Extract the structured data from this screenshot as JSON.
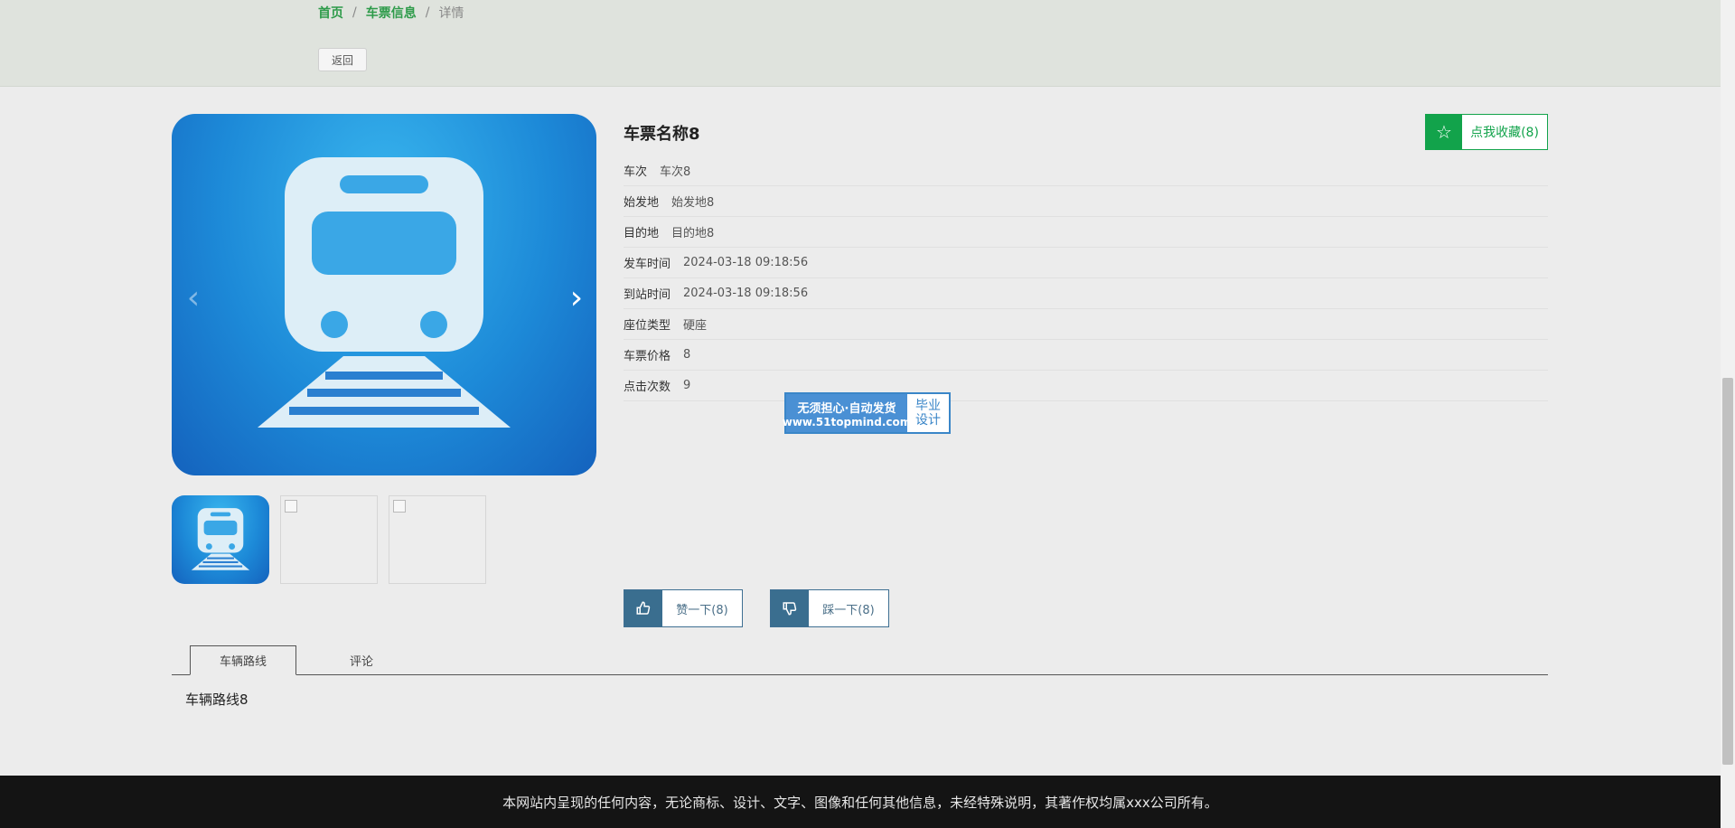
{
  "breadcrumb": {
    "home": "首页",
    "sep1": "/",
    "list": "车票信息",
    "sep2": "/",
    "current": "详情"
  },
  "back_label": "返回",
  "carousel": {
    "prev": "‹",
    "next": "›"
  },
  "ticket": {
    "title": "车票名称8",
    "favorite_label": "点我收藏(8)",
    "fields": [
      {
        "label": "车次",
        "value": "车次8"
      },
      {
        "label": "始发地",
        "value": "始发地8"
      },
      {
        "label": "目的地",
        "value": "目的地8"
      },
      {
        "label": "发车时间",
        "value": "2024-03-18 09:18:56"
      },
      {
        "label": "到站时间",
        "value": "2024-03-18 09:18:56"
      },
      {
        "label": "座位类型",
        "value": "硬座"
      },
      {
        "label": "车票价格",
        "value": "8"
      },
      {
        "label": "点击次数",
        "value": "9"
      }
    ]
  },
  "watermark": {
    "line1": "无须担心·自动发货",
    "line2": "www.51topmind.com",
    "right1": "毕业",
    "right2": "设计"
  },
  "votes": {
    "up_label": "赞一下(8)",
    "down_label": "踩一下(8)"
  },
  "tabs": [
    {
      "label": "车辆路线"
    },
    {
      "label": "评论"
    }
  ],
  "tab_content": "车辆路线8",
  "footer": "本网站内呈现的任何内容，无论商标、设计、文字、图像和任何其他信息，未经特殊说明，其著作权均属xxx公司所有。",
  "colors": {
    "accent_green": "#12a34b",
    "vote_blue": "#3a6e8f",
    "footer_bg": "#141414"
  },
  "icons": {
    "favorite": "star-icon",
    "up": "thumbs-up-icon",
    "down": "thumbs-down-icon"
  }
}
